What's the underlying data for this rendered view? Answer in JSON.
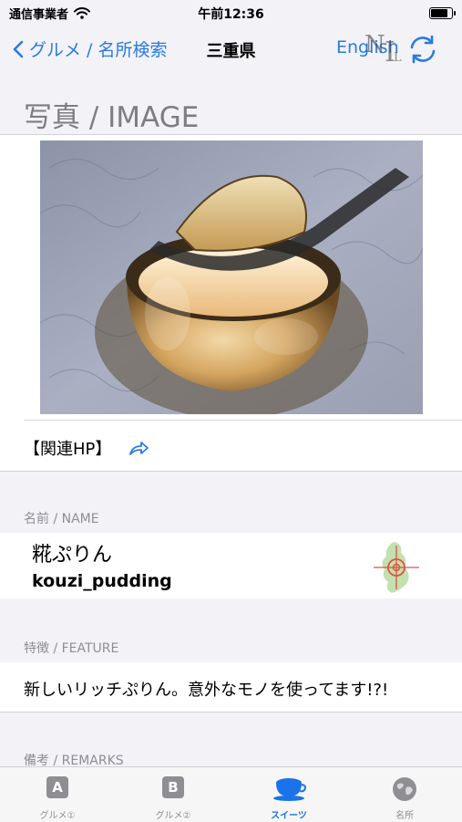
{
  "status_bar": {
    "carrier": "通信事業者",
    "time": "午前12:36",
    "battery_level": 0.9
  },
  "nav": {
    "back_label": "グルメ / 名所検索",
    "title": "三重県",
    "language_label": "English",
    "logo_letters": [
      "N",
      "I",
      "L"
    ]
  },
  "image_section": {
    "title": "写真 / IMAGE",
    "related_hp_label": "【関連HP】"
  },
  "name_section": {
    "header": "名前 / NAME",
    "name_ja": "糀ぷりん",
    "name_en": "kouzi_pudding"
  },
  "feature_section": {
    "header": "特徴 / FEATURE",
    "text": "新しいリッチぷりん。意外なモノを使ってます!?!"
  },
  "remarks_section": {
    "header": "備考 / REMARKS"
  },
  "tabs": [
    {
      "icon_text": "A",
      "label": "グルメ①",
      "icon": "letter-a-icon"
    },
    {
      "icon_text": "B",
      "label": "グルメ②",
      "icon": "letter-b-icon"
    },
    {
      "label": "スイーツ",
      "icon": "teacup-icon",
      "active": true
    },
    {
      "label": "名所",
      "icon": "globe-icon"
    }
  ],
  "colors": {
    "accent": "#2a7be0",
    "tab_active": "#1a73e8",
    "tab_inactive": "#8e8e93",
    "background": "#f2f2f7"
  }
}
